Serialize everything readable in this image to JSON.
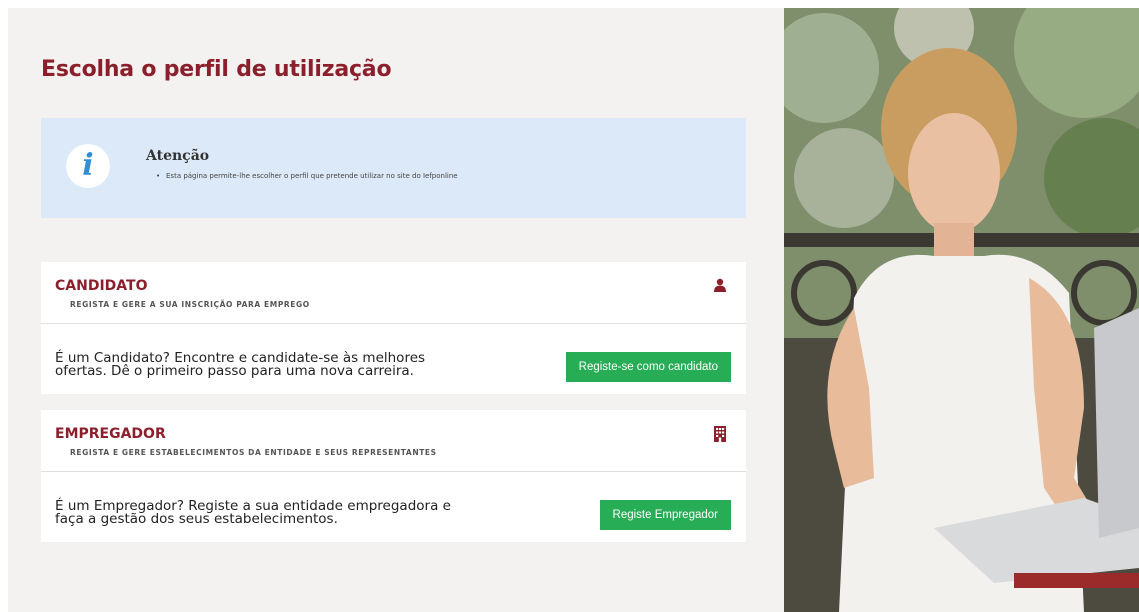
{
  "page": {
    "title": "Escolha o perfil de utilização"
  },
  "notice": {
    "icon": "info-icon",
    "title": "Atenção",
    "item": "Esta página permite-lhe escolher o perfil que pretende utilizar no site do Iefponline"
  },
  "candidate": {
    "title": "CANDIDATO",
    "subtitle": "REGISTA E GERE A SUA INSCRIÇÃO PARA EMPREGO",
    "icon": "user-icon",
    "text_line1": "É um Candidato? Encontre e candidate-se às melhores",
    "text_line2": "ofertas. Dê o primeiro passo para uma nova carreira.",
    "button": "Registe-se como candidato"
  },
  "employer": {
    "title": "EMPREGADOR",
    "subtitle": "REGISTA E GERE ESTABELECIMENTOS DA ENTIDADE E SEUS REPRESENTANTES",
    "icon": "building-icon",
    "text_line1": "É um Empregador? Registe a sua entidade empregadora e",
    "text_line2": "faça a gestão dos seus estabelecimentos.",
    "button": "Registe Empregador"
  },
  "colors": {
    "brand": "#8b1f2b",
    "button": "#27ad55",
    "notice_bg": "#dce9f8",
    "info_icon": "#2f8fd2"
  }
}
